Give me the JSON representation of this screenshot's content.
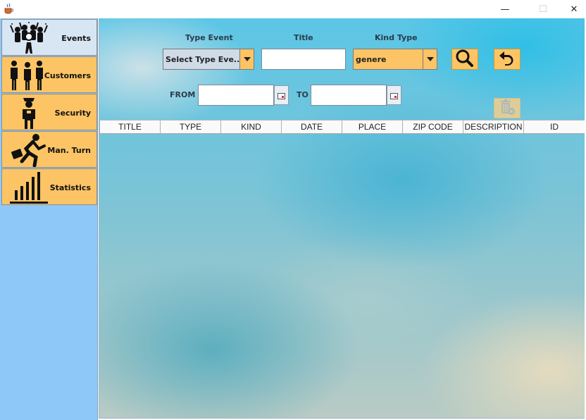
{
  "window": {
    "minimize_glyph": "—",
    "maximize_glyph": "☐",
    "close_glyph": "✕"
  },
  "sidebar": {
    "items": [
      {
        "label": "Events",
        "icon": "crowd-icon",
        "active": true
      },
      {
        "label": "Customers",
        "icon": "people-icon",
        "active": false
      },
      {
        "label": "Security",
        "icon": "guard-icon",
        "active": false
      },
      {
        "label": "Man. Turn",
        "icon": "running-man-icon",
        "active": false
      },
      {
        "label": "Statistics",
        "icon": "bar-chart-icon",
        "active": false
      }
    ]
  },
  "filters": {
    "type_event_label": "Type Event",
    "title_label": "Title",
    "kind_type_label": "Kind Type",
    "type_event_value": "Select Type Eve...",
    "title_value": "",
    "kind_type_value": "genere",
    "from_label": "FROM",
    "to_label": "TO",
    "from_value": "",
    "to_value": ""
  },
  "buttons": {
    "search": "search-icon",
    "back": "undo-arrow-icon",
    "delete": "trash-delete-icon"
  },
  "table": {
    "columns": [
      "TITLE",
      "TYPE",
      "KIND",
      "DATE",
      "PLACE",
      "ZIP CODE",
      "DESCRIPTION",
      "ID"
    ],
    "rows": []
  },
  "colors": {
    "accent_orange": "#fcc464",
    "sidebar_blue": "#8ec8f8",
    "active_nav": "#d8e6f4"
  }
}
